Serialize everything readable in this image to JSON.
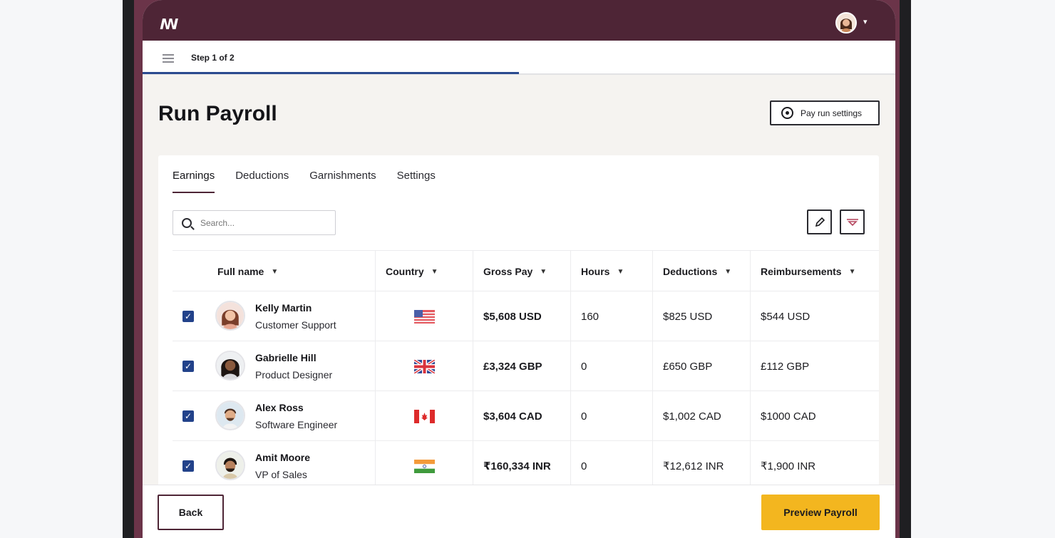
{
  "app": {
    "logo_text": "ꟿ"
  },
  "header": {
    "avatar": "user-avatar",
    "menu_icon": "chevron-down-icon"
  },
  "step": {
    "label": "Step 1 of 2",
    "progress_fraction": 0.5
  },
  "page": {
    "title": "Run Payroll",
    "settings_button": "Pay run settings"
  },
  "tabs": [
    {
      "label": "Earnings",
      "active": true
    },
    {
      "label": "Deductions",
      "active": false
    },
    {
      "label": "Garnishments",
      "active": false
    },
    {
      "label": "Settings",
      "active": false
    }
  ],
  "search": {
    "placeholder": "Search..."
  },
  "table": {
    "columns": [
      "Full name",
      "Country",
      "Gross Pay",
      "Hours",
      "Deductions",
      "Reimbursements"
    ],
    "rows": [
      {
        "name": "Kelly Martin",
        "role": "Customer Support",
        "country": "us-flag",
        "gross_pay": "$5,608 USD",
        "hours": "160",
        "deductions": "$825 USD",
        "reimbursements": "$544 USD",
        "checked": true
      },
      {
        "name": "Gabrielle Hill",
        "role": "Product Designer",
        "country": "uk-flag",
        "gross_pay": "£3,324 GBP",
        "hours": "0",
        "deductions": "£650 GBP",
        "reimbursements": "£112 GBP",
        "checked": true
      },
      {
        "name": "Alex Ross",
        "role": "Software Engineer",
        "country": "canada-flag",
        "gross_pay": "$3,604 CAD",
        "hours": "0",
        "deductions": "$1,002 CAD",
        "reimbursements": "$1000 CAD",
        "checked": true
      },
      {
        "name": "Amit Moore",
        "role": "VP of Sales",
        "country": "india-flag",
        "gross_pay": "₹160,334 INR",
        "hours": "0",
        "deductions": "₹12,612 INR",
        "reimbursements": "₹1,900 INR",
        "checked": true
      }
    ]
  },
  "footer": {
    "back_label": "Back",
    "preview_label": "Preview Payroll"
  },
  "colors": {
    "topbar": "#4e2536",
    "accent_blue": "#22428a",
    "primary_button": "#f3b61f"
  }
}
